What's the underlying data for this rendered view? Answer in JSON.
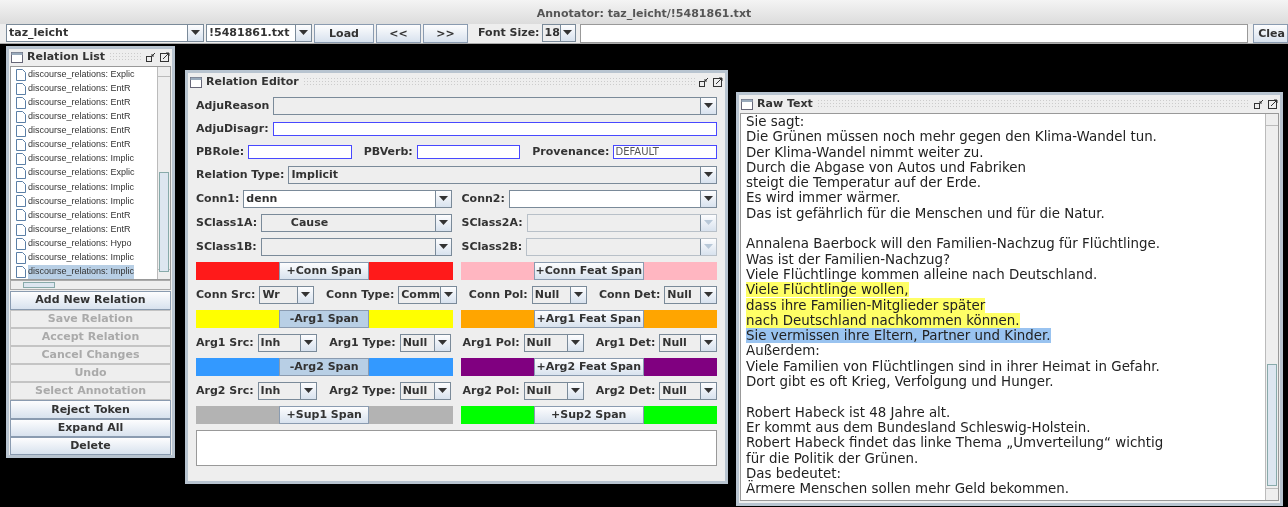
{
  "window": {
    "title": "Annotator:  taz_leicht/!5481861.txt"
  },
  "toolbar": {
    "corpus": "taz_leicht",
    "file": "!5481861.txt",
    "buttons": [
      "Load",
      "<<",
      ">>"
    ],
    "font_size_label": "Font Size:",
    "font_size": "18",
    "clear_button": "Clea"
  },
  "relation_list": {
    "title": "Relation List",
    "items": [
      {
        "text": "discourse_relations: Explic",
        "selected": false
      },
      {
        "text": "discourse_relations: EntR",
        "selected": false
      },
      {
        "text": "discourse_relations: EntR",
        "selected": false
      },
      {
        "text": "discourse_relations: EntR",
        "selected": false
      },
      {
        "text": "discourse_relations: EntR",
        "selected": false
      },
      {
        "text": "discourse_relations: EntR",
        "selected": false
      },
      {
        "text": "discourse_relations: Implic",
        "selected": false
      },
      {
        "text": "discourse_relations: Explic",
        "selected": false
      },
      {
        "text": "discourse_relations: Implic",
        "selected": false
      },
      {
        "text": "discourse_relations: Implic",
        "selected": false
      },
      {
        "text": "discourse_relations: EntR",
        "selected": false
      },
      {
        "text": "discourse_relations: EntR",
        "selected": false
      },
      {
        "text": "discourse_relations: Hypo",
        "selected": false
      },
      {
        "text": "discourse_relations: Implic",
        "selected": false
      },
      {
        "text": "discourse_relations: Implic",
        "selected": true
      }
    ],
    "buttons": [
      {
        "label": "Add New Relation",
        "disabled": false
      },
      {
        "label": "Save Relation",
        "disabled": true
      },
      {
        "label": "Accept Relation",
        "disabled": true
      },
      {
        "label": "Cancel Changes",
        "disabled": true
      },
      {
        "label": "Undo",
        "disabled": true
      },
      {
        "label": "Select Annotation",
        "disabled": true
      },
      {
        "label": "Reject Token",
        "disabled": false
      },
      {
        "label": "Expand All",
        "disabled": false
      },
      {
        "label": "Delete",
        "disabled": false
      }
    ]
  },
  "relation_editor": {
    "title": "Relation Editor",
    "rows": [
      {
        "kind": "combo",
        "label": "AdjuReason"
      },
      {
        "kind": "fields",
        "items": [
          {
            "label": "AdjuDisagr:"
          }
        ]
      },
      {
        "kind": "fields",
        "items": [
          {
            "label": "PBRole:"
          },
          {
            "label": "PBVerb:"
          },
          {
            "label": "Provenance:",
            "value": "DEFAULT"
          }
        ]
      },
      {
        "kind": "combo",
        "label": "Relation Type:",
        "value": "Implicit"
      },
      {
        "kind": "pair",
        "items": [
          {
            "label": "Conn1:",
            "value": "denn",
            "editable": true,
            "disabled": false
          },
          {
            "label": "Conn2:",
            "editable": true,
            "disabled": false
          }
        ]
      },
      {
        "kind": "pair",
        "items": [
          {
            "label": "SClass1A:",
            "value": "       Cause",
            "editable": false,
            "disabled": false
          },
          {
            "label": "SClass2A:",
            "editable": false,
            "disabled": true
          }
        ]
      },
      {
        "kind": "pair",
        "items": [
          {
            "label": "SClass1B:",
            "editable": false,
            "disabled": false
          },
          {
            "label": "SClass2B:",
            "editable": false,
            "disabled": true
          }
        ]
      },
      {
        "kind": "spans",
        "items": [
          {
            "label": "+Conn Span",
            "color": "#ff1a1a",
            "pressed": false
          },
          {
            "label": "+Conn Feat Span",
            "color": "#ffb6c1",
            "pressed": false
          }
        ]
      },
      {
        "kind": "attrs",
        "items": [
          {
            "label": "Conn Src:",
            "value": "Wr"
          },
          {
            "label": "Conn Type:",
            "value": "Comm"
          },
          {
            "label": "Conn Pol:",
            "value": "Null"
          },
          {
            "label": "Conn Det:",
            "value": "Null"
          }
        ]
      },
      {
        "kind": "spans",
        "items": [
          {
            "label": "-Arg1 Span",
            "color": "#ffff00",
            "pressed": true
          },
          {
            "label": "+Arg1 Feat Span",
            "color": "#ffa500",
            "pressed": false
          }
        ]
      },
      {
        "kind": "attrs",
        "items": [
          {
            "label": "Arg1 Src:",
            "value": "Inh"
          },
          {
            "label": "Arg1 Type:",
            "value": "Null"
          },
          {
            "label": "Arg1 Pol:",
            "value": "Null"
          },
          {
            "label": "Arg1 Det:",
            "value": "Null"
          }
        ]
      },
      {
        "kind": "spans",
        "items": [
          {
            "label": "-Arg2 Span",
            "color": "#3399ff",
            "pressed": true
          },
          {
            "label": "+Arg2 Feat Span",
            "color": "#800080",
            "pressed": false
          }
        ]
      },
      {
        "kind": "attrs",
        "items": [
          {
            "label": "Arg2 Src:",
            "value": "Inh"
          },
          {
            "label": "Arg2 Type:",
            "value": "Null"
          },
          {
            "label": "Arg2 Pol:",
            "value": "Null"
          },
          {
            "label": "Arg2 Det:",
            "value": "Null"
          }
        ]
      },
      {
        "kind": "spans",
        "items": [
          {
            "label": "+Sup1 Span",
            "color": "#b3b3b3",
            "pressed": false
          },
          {
            "label": "+Sup2 Span",
            "color": "#00ff00",
            "pressed": false
          }
        ]
      },
      {
        "kind": "notes"
      }
    ]
  },
  "raw_text": {
    "title": "Raw Text",
    "paragraphs": [
      [
        {
          "text": "Sie sagt:"
        },
        {
          "text": "Die Grünen müssen noch mehr gegen den Klima-Wandel tun."
        },
        {
          "text": "Der Klima-Wandel nimmt weiter zu."
        },
        {
          "text": "Durch die Abgase von Autos und Fabriken"
        },
        {
          "text": "steigt die Temperatur auf der Erde."
        },
        {
          "text": "Es wird immer wärmer."
        },
        {
          "text": "Das ist gefährlich für die Menschen und für die Natur."
        }
      ],
      [
        {
          "text": "Annalena Baerbock will den Familien-Nachzug für Flüchtlinge."
        },
        {
          "text": "Was ist der Familien-Nachzug?"
        },
        {
          "text": "Viele Flüchtlinge kommen alleine nach Deutschland."
        },
        {
          "text": "Viele Flüchtlinge wollen,",
          "color": "#ffff66"
        },
        {
          "text": "dass ihre Familien-Mitglieder später",
          "color": "#ffff66"
        },
        {
          "text": "nach Deutschland nachkommen können.",
          "color": "#ffff66"
        },
        {
          "text": "Sie vermissen ihre Eltern, Partner und Kinder.",
          "color": "#99c3f0"
        },
        {
          "text": "Außerdem:"
        },
        {
          "text": "Viele Familien von Flüchtlingen sind in ihrer Heimat in Gefahr."
        },
        {
          "text": "Dort gibt es oft Krieg, Verfolgung und Hunger."
        }
      ],
      [
        {
          "text": "Robert Habeck ist 48 Jahre alt."
        },
        {
          "text": "Er kommt aus dem Bundesland Schleswig-Holstein."
        },
        {
          "text": "Robert Habeck findet das linke Thema „Umverteilung“ wichtig"
        },
        {
          "text": "für die Politik der Grünen."
        },
        {
          "text": "Das bedeutet:"
        },
        {
          "text": "Ärmere Menschen sollen mehr Geld bekommen."
        }
      ]
    ]
  }
}
